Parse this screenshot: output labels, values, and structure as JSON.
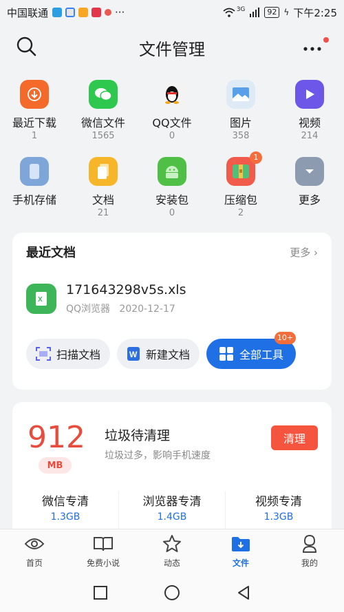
{
  "status_bar": {
    "carrier": "中国联通",
    "battery": "92",
    "time": "下午2:25",
    "network": "3G"
  },
  "header": {
    "title": "文件管理"
  },
  "categories": [
    {
      "label": "最近下载",
      "count": "1",
      "icon": "download-icon",
      "color": "#f36a2a"
    },
    {
      "label": "微信文件",
      "count": "1565",
      "icon": "wechat-icon",
      "color": "#2dc84d"
    },
    {
      "label": "QQ文件",
      "count": "0",
      "icon": "qq-penguin-icon",
      "color": "#f3f3f3"
    },
    {
      "label": "图片",
      "count": "358",
      "icon": "image-icon",
      "color": "#dfeaf7"
    },
    {
      "label": "视频",
      "count": "214",
      "icon": "video-play-icon",
      "color": "#6d57e8"
    },
    {
      "label": "手机存储",
      "count": "",
      "icon": "phone-storage-icon",
      "color": "#7fa6d9"
    },
    {
      "label": "文档",
      "count": "21",
      "icon": "document-icon",
      "color": "#f7b52a"
    },
    {
      "label": "安装包",
      "count": "0",
      "icon": "android-icon",
      "color": "#4fbf45"
    },
    {
      "label": "压缩包",
      "count": "2",
      "icon": "archive-icon",
      "color": "#f05b4b",
      "badge": "1"
    },
    {
      "label": "更多",
      "count": "",
      "icon": "more-chevron-icon",
      "color": "#8d9bb0"
    }
  ],
  "recent_docs": {
    "title": "最近文档",
    "more": "更多",
    "file_name": "171643298v5s.xls",
    "file_source": "QQ浏览器",
    "file_date": "2020-12-17",
    "tools": [
      {
        "label": "扫描文档",
        "icon": "scan-icon"
      },
      {
        "label": "新建文档",
        "icon": "word-icon"
      },
      {
        "label": "全部工具",
        "icon": "grid-icon",
        "badge": "10+"
      }
    ]
  },
  "junk": {
    "size": "912",
    "unit": "MB",
    "title": "垃圾待清理",
    "desc": "垃圾过多，影响手机速度",
    "clean_label": "清理",
    "items": [
      {
        "name": "微信专清",
        "value": "1.3GB"
      },
      {
        "name": "浏览器专清",
        "value": "1.4GB"
      },
      {
        "name": "视频专清",
        "value": "1.3GB"
      }
    ]
  },
  "bottom_nav": [
    {
      "label": "首页",
      "icon": "eye-icon"
    },
    {
      "label": "免费小说",
      "icon": "book-icon"
    },
    {
      "label": "动态",
      "icon": "star-icon"
    },
    {
      "label": "文件",
      "icon": "folder-icon",
      "active": true
    },
    {
      "label": "我的",
      "icon": "person-icon"
    }
  ],
  "colors": {
    "accent": "#1f6fe5",
    "danger": "#e84c3d"
  }
}
